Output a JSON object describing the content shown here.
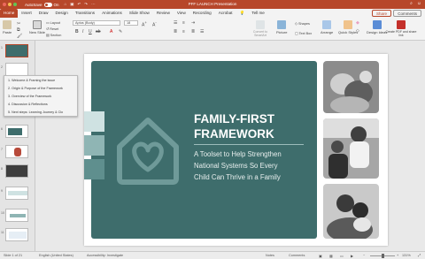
{
  "titlebar": {
    "autosave_label": "AutoSave",
    "toggle_state": "On",
    "document_title": "PFF LAUNCH Presentation",
    "search_label": "Tell me",
    "traffic_colors": [
      "#ed6a5e",
      "#f5bf4f",
      "#62c554"
    ]
  },
  "tabs": [
    "Home",
    "Insert",
    "Draw",
    "Design",
    "Transitions",
    "Animations",
    "Slide Show",
    "Review",
    "View",
    "Recording",
    "Acrobat"
  ],
  "tell_me": "Tell me",
  "share_label": "Share",
  "comments_label": "Comments",
  "ribbon": {
    "paste": "Paste",
    "new_slide": "New Slide",
    "layout": "Layout",
    "reset": "Reset",
    "section": "Section",
    "font_name": "Aptos (Body)",
    "font_size": "18",
    "convert_smartart": "Convert to SmartArt",
    "picture": "Picture",
    "text_box": "Text Box",
    "shapes": "Shapes",
    "arrange": "Arrange",
    "quick_styles": "Quick Styles",
    "design_ideas": "Design Ideas",
    "create_pdf": "Create PDF and share link"
  },
  "thumbnails": [
    "1",
    "2",
    "3",
    "4",
    "5",
    "6",
    "7",
    "8",
    "9",
    "10",
    "11",
    "12"
  ],
  "outline_items": [
    "1. Welcome & Framing the issue",
    "2. Origin & Purpose of the Framework",
    "3. Overview of the Framework",
    "4. Discussion & Reflections",
    "5. Next steps: Learning Journey & Clo"
  ],
  "slide": {
    "title_line1": "FAMILY-FIRST",
    "title_line2": "FRAMEWORK",
    "subtitle_line1": "A Toolset to Help Strengthen",
    "subtitle_line2": "National Systems So Every",
    "subtitle_line3": "Child Can Thrive in a Family",
    "logo_icon": "house-heart-icon",
    "accent_color": "#3e6d6c",
    "square_colors": [
      "#cfe2e2",
      "#8fb5b4",
      "#5f8f8e"
    ],
    "photos": [
      "family-photo-1",
      "family-photo-2",
      "family-photo-3"
    ]
  },
  "status": {
    "slide_info": "Slide 1 of 21",
    "language": "English (United States)",
    "accessibility": "Accessibility: Investigate",
    "notes": "Notes",
    "comments": "Comments",
    "zoom": "131%"
  }
}
